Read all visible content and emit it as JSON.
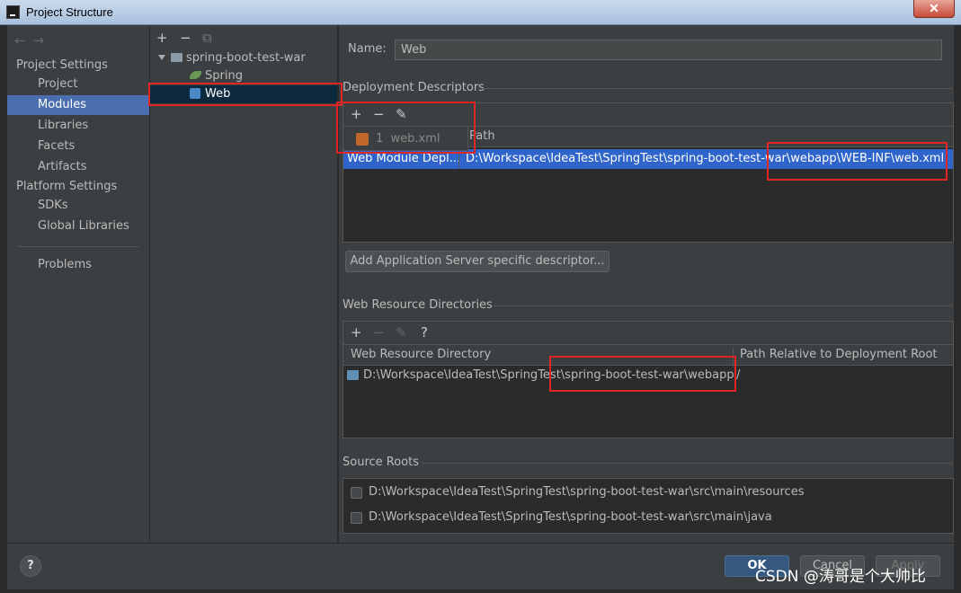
{
  "window": {
    "title": "Project Structure",
    "close_glyph": "✕",
    "app_icon": "intellij-icon"
  },
  "sidebar": {
    "nav_back": "←",
    "nav_forward": "→",
    "project_settings_header": "Project Settings",
    "project_items": [
      "Project",
      "Modules",
      "Libraries",
      "Facets",
      "Artifacts"
    ],
    "platform_settings_header": "Platform Settings",
    "platform_items": [
      "SDKs",
      "Global Libraries"
    ],
    "problems": "Problems",
    "selected": "Modules"
  },
  "tree": {
    "toolbar": {
      "add": "+",
      "remove": "−",
      "copy": "⧉"
    },
    "nodes": [
      {
        "label": "spring-boot-test-war",
        "icon": "module-folder-icon"
      },
      {
        "label": "Spring",
        "icon": "spring-leaf-icon"
      },
      {
        "label": "Web",
        "icon": "web-facet-icon"
      }
    ],
    "selected": "Web"
  },
  "facet": {
    "name_label": "Name:",
    "name_value": "Web",
    "deployment_descriptors": {
      "header": "Deployment Descriptors",
      "toolbar": {
        "add": "+",
        "remove": "−",
        "edit": "✎"
      },
      "path_column": "Path",
      "row": {
        "type": "Web Module Depl...",
        "path": "D:\\Workspace\\IdeaTest\\SpringTest\\spring-boot-test-war\\webapp\\WEB-INF\\web.xml"
      },
      "popup_item": {
        "index": "1",
        "label": "web.xml"
      }
    },
    "add_server_descriptor_button": "Add Application Server specific descriptor...",
    "web_resource_directories": {
      "header": "Web Resource Directories",
      "toolbar": {
        "add": "+",
        "remove": "−",
        "edit": "✎",
        "help": "?"
      },
      "columns": [
        "Web Resource Directory",
        "Path Relative to Deployment Root"
      ],
      "row": {
        "directory": "D:\\Workspace\\IdeaTest\\SpringTest\\spring-boot-test-war\\webapp",
        "relative": "/"
      }
    },
    "source_roots": {
      "header": "Source Roots",
      "items": [
        "D:\\Workspace\\IdeaTest\\SpringTest\\spring-boot-test-war\\src\\main\\resources",
        "D:\\Workspace\\IdeaTest\\SpringTest\\spring-boot-test-war\\src\\main\\java"
      ]
    }
  },
  "footer": {
    "help": "?",
    "ok": "OK",
    "cancel": "Cancel",
    "apply": "Apply"
  },
  "watermark": "CSDN @涛哥是个大帅比",
  "colors": {
    "accent": "#4b6eaf",
    "selection": "#2f65ca",
    "highlight_box": "#e02525",
    "background": "#3c3f41"
  }
}
